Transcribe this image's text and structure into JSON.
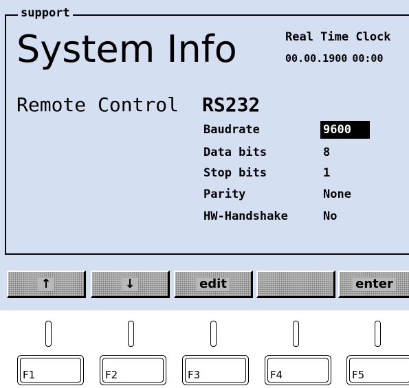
{
  "group_label": "support",
  "title": "System Info",
  "rtc": {
    "label": "Real Time Clock",
    "value": "00.00.1900 00:00"
  },
  "section": "Remote Control",
  "protocol": "RS232",
  "params": [
    {
      "name": "Baudrate",
      "value": "9600",
      "selected": true
    },
    {
      "name": "Data bits",
      "value": "8"
    },
    {
      "name": "Stop bits",
      "value": "1"
    },
    {
      "name": "Parity",
      "value": "None"
    },
    {
      "name": "HW-Handshake",
      "value": "No"
    }
  ],
  "softkeys": [
    {
      "label": "↑",
      "icon": "arrow-up-icon"
    },
    {
      "label": "↓",
      "icon": "arrow-down-icon"
    },
    {
      "label": "edit"
    },
    {
      "label": ""
    },
    {
      "label": "enter"
    }
  ],
  "fkeys": [
    "F1",
    "F2",
    "F3",
    "F4",
    "F5"
  ],
  "colors": {
    "lcd_background": "#d4e0f2",
    "softkey_background": "#b9b9b9"
  }
}
